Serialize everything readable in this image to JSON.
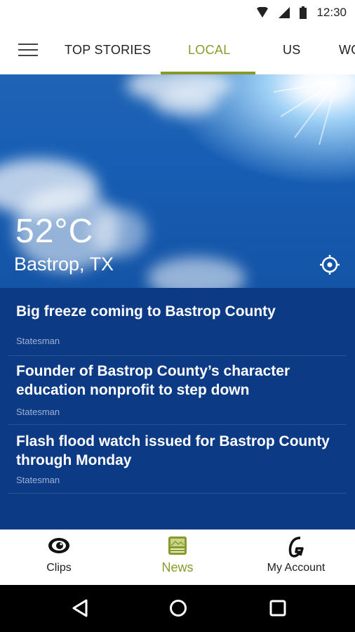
{
  "status_bar": {
    "time": "12:30"
  },
  "top_nav": {
    "tabs": [
      {
        "label": "TOP STORIES",
        "active": false
      },
      {
        "label": "LOCAL",
        "active": true
      },
      {
        "label": "US",
        "active": false
      },
      {
        "label": "WO",
        "active": false
      }
    ],
    "accent": "#8a9a2a"
  },
  "weather": {
    "temperature": "52°C",
    "location": "Bastrop, TX"
  },
  "news": {
    "background": "#0d3a84",
    "items": [
      {
        "headline": "Big freeze coming to Bastrop County",
        "source": "Statesman"
      },
      {
        "headline": "Founder of Bastrop County’s character education nonprofit to step down",
        "source": "Statesman"
      },
      {
        "headline": "Flash flood watch issued for Bastrop County through Monday",
        "source": "Statesman"
      }
    ]
  },
  "bottom_nav": {
    "items": [
      {
        "label": "Clips",
        "icon": "eye-icon",
        "active": false
      },
      {
        "label": "News",
        "icon": "news-icon",
        "active": true
      },
      {
        "label": "My Account",
        "icon": "account-icon",
        "active": false
      }
    ]
  }
}
